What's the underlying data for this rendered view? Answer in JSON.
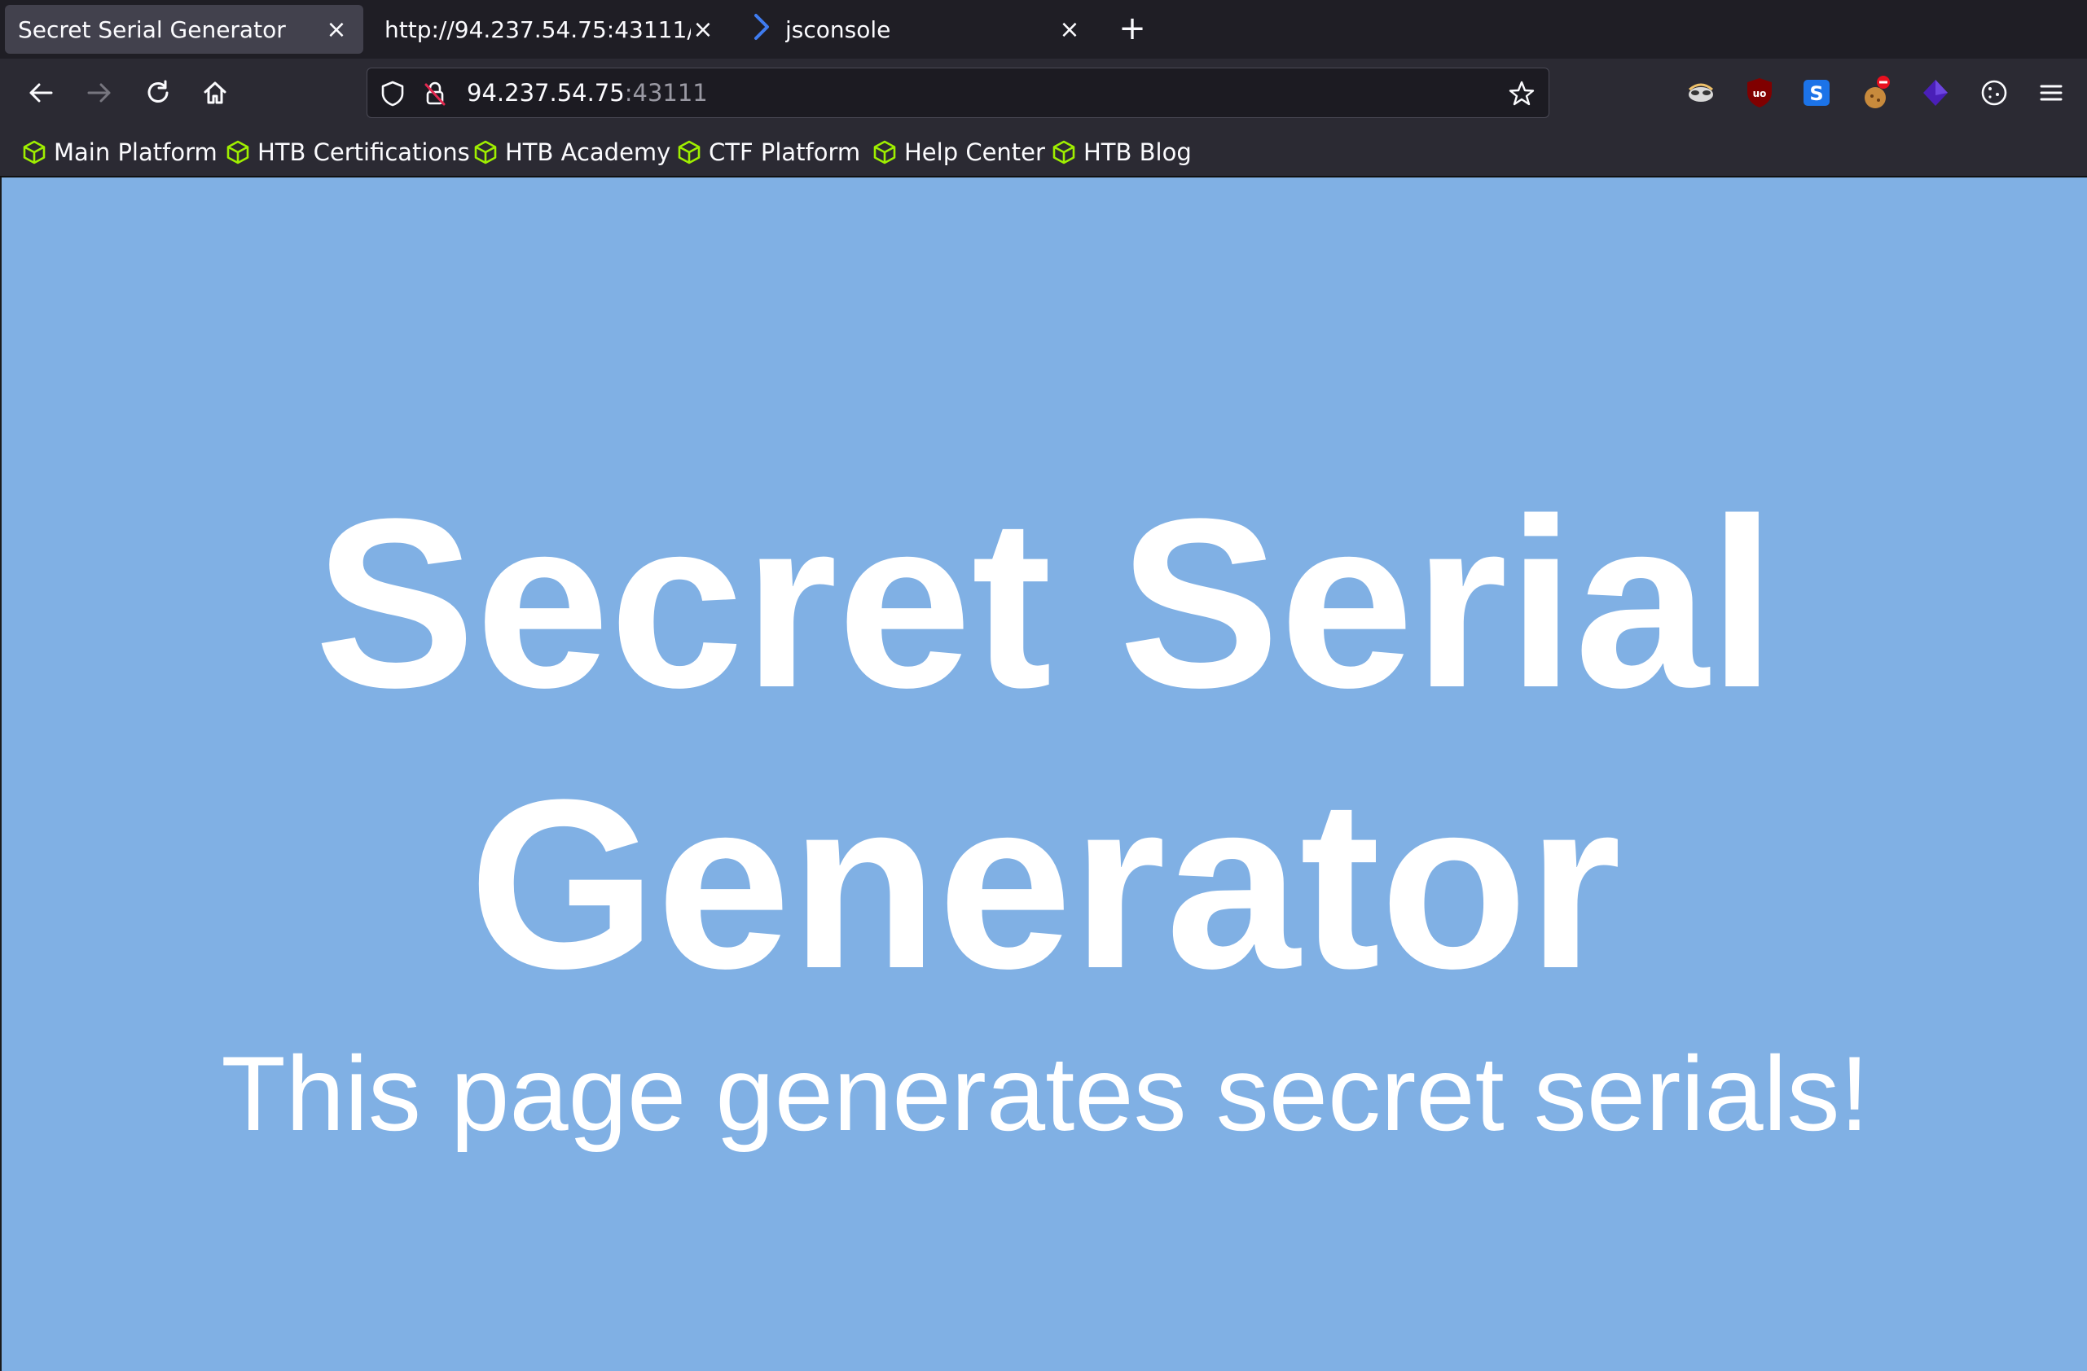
{
  "browser": {
    "tabs": [
      {
        "title": "Secret Serial Generator",
        "active": true
      },
      {
        "title": "http://94.237.54.75:43111/",
        "active": false
      },
      {
        "title": "jsconsole",
        "active": false
      }
    ],
    "new_tab_glyph": "+",
    "close_glyph": "×",
    "url": {
      "host": "94.237.54.75",
      "port": ":43111"
    },
    "bookmarks": [
      "Main Platform",
      "HTB Certifications",
      "HTB Academy",
      "CTF Platform",
      "Help Center",
      "HTB Blog"
    ],
    "extensions": [
      "hacker-mask-icon",
      "ublock-icon",
      "s-extension-icon",
      "cookie-blocker-icon",
      "purple-cube-icon",
      "cookie-icon"
    ],
    "colors": {
      "bookmark_icon": "#9fef00",
      "page_background": "#80b0e4",
      "tab_active": "#42414d"
    }
  },
  "page": {
    "title": "Secret Serial Generator",
    "subtitle": "This page generates secret serials!"
  }
}
